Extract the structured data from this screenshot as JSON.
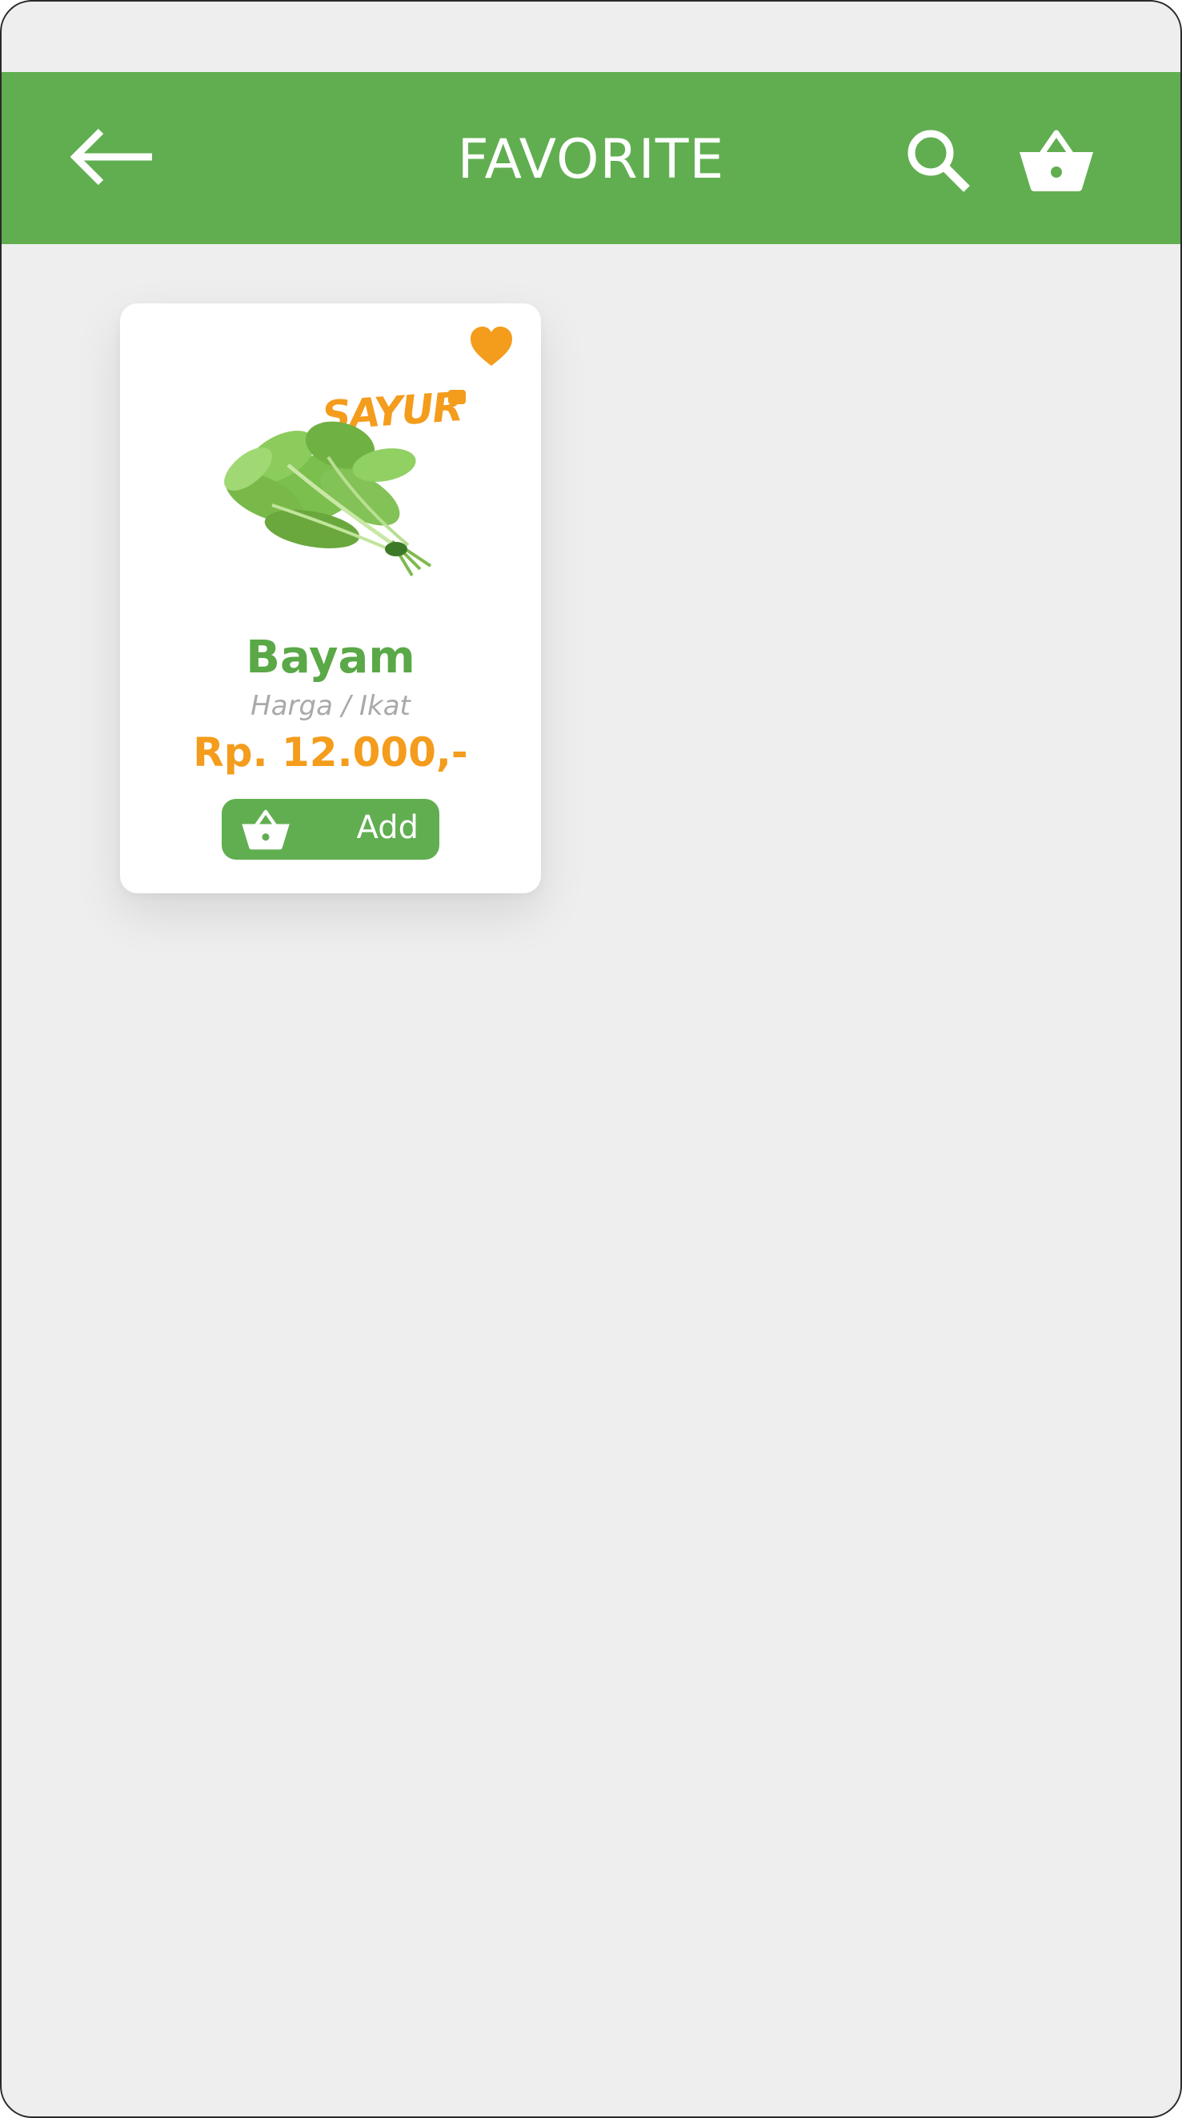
{
  "header": {
    "title": "FAVORITE"
  },
  "products": [
    {
      "name": "Bayam",
      "unit": "Harga / Ikat",
      "price": "Rp. 12.000,-",
      "add_label": "Add",
      "favorited": true,
      "brand_logo": "SAYUR"
    }
  ],
  "colors": {
    "primary": "#61ae51",
    "accent": "#f49c1c",
    "background": "#eeeeee",
    "card": "#ffffff",
    "muted_text": "#a9a9a9"
  },
  "icons": {
    "back": "arrow-left-icon",
    "search": "search-icon",
    "cart": "basket-icon",
    "favorite": "heart-icon"
  }
}
